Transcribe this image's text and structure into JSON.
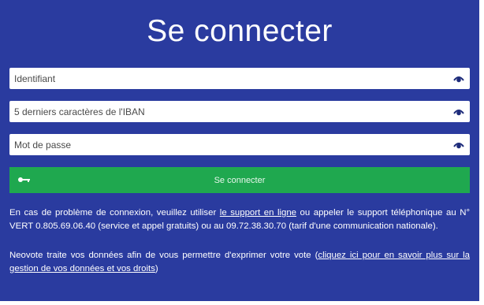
{
  "colors": {
    "panel_background": "#2a3b9f",
    "input_background": "#ffffff",
    "button_background": "#1fa84f",
    "eye_icon": "#1d2b7a"
  },
  "login": {
    "title": "Se connecter",
    "fields": [
      {
        "placeholder": "Identifiant",
        "icon": "eye-icon"
      },
      {
        "placeholder": "5 derniers caractères de l'IBAN",
        "icon": "eye-icon"
      },
      {
        "placeholder": "Mot de passe",
        "icon": "eye-icon"
      }
    ],
    "submit": {
      "label": "Se connecter",
      "icon": "key-icon"
    }
  },
  "help": {
    "p1_before": "En cas de problème de connexion, veuillez utiliser ",
    "p1_link": "le support en ligne",
    "p1_after": " ou appeler le support téléphonique au N° VERT 0.805.69.06.40 (service et appel gratuits) ou au 09.72.38.30.70 (tarif d'une communication nationale).",
    "p2_before": "Neovote traite vos données afin de vous permettre d'exprimer votre vote (",
    "p2_link": "cliquez ici pour en savoir plus sur la gestion de vos données et vos droits",
    "p2_after": ")"
  }
}
